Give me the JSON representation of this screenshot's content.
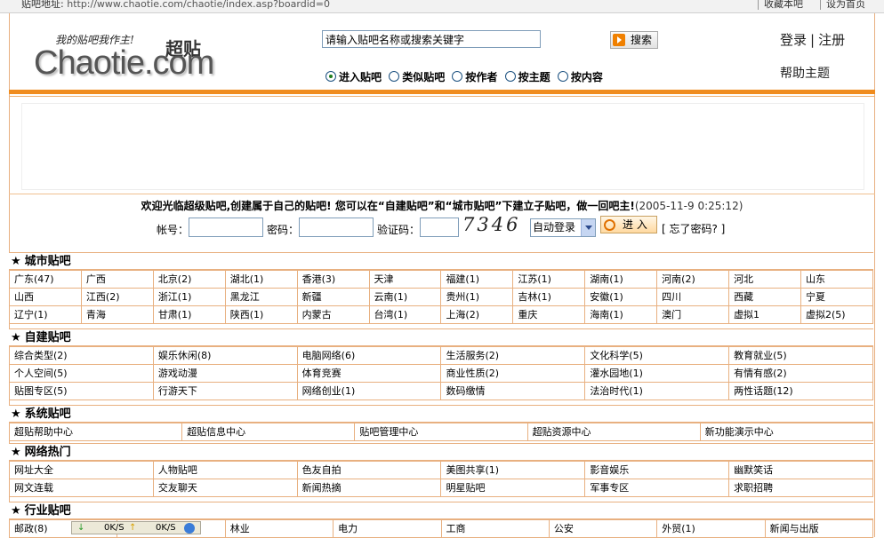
{
  "topbar": {
    "address_label": "贴吧地址:",
    "address_url": "http://www.chaotie.com/chaotie/index.asp?boardid=0",
    "bookmark": "收藏本吧",
    "homepage": "设为首页"
  },
  "logo": {
    "slogan": "我的贴吧我作主!",
    "cn_name": "超贴",
    "en_name": "Chaotie.com"
  },
  "search": {
    "value": "请输入贴吧名称或搜索关键字",
    "button": "搜索",
    "options": [
      "进入贴吧",
      "类似贴吧",
      "按作者",
      "按主题",
      "按内容"
    ],
    "selected_index": 0
  },
  "header_links": {
    "login": "登录",
    "register": "注册",
    "help": "帮助主题"
  },
  "welcome": {
    "text": "欢迎光临超级贴吧,创建属于自己的贴吧! 您可以在“自建贴吧”和“城市贴吧”下建立子贴吧，做一回吧主!",
    "time": "(2005-11-9 0:25:12)"
  },
  "login_form": {
    "user_label": "帐号：",
    "password_label": "密码：",
    "captcha_label": "验证码：",
    "captcha_code": "7346",
    "auto_login": "自动登录",
    "enter": "进 入",
    "forgot": "[ 忘了密码? ]"
  },
  "sections": [
    {
      "title": "城市贴吧",
      "rows": [
        [
          "广东(47)",
          "广西",
          "北京(2)",
          "湖北(1)",
          "香港(3)",
          "天津",
          "福建(1)",
          "江苏(1)",
          "湖南(1)",
          "河南(2)",
          "河北",
          "山东"
        ],
        [
          "山西",
          "江西(2)",
          "浙江(1)",
          "黑龙江",
          "新疆",
          "云南(1)",
          "贵州(1)",
          "吉林(1)",
          "安徽(1)",
          "四川",
          "西藏",
          "宁夏"
        ],
        [
          "辽宁(1)",
          "青海",
          "甘肃(1)",
          "陕西(1)",
          "内蒙古",
          "台湾(1)",
          "上海(2)",
          "重庆",
          "海南(1)",
          "澳门",
          "虚拟1",
          "虚拟2(5)"
        ]
      ]
    },
    {
      "title": "自建贴吧",
      "rows": [
        [
          "综合类型(2)",
          "娱乐休闲(8)",
          "电脑网络(6)",
          "生活服务(2)",
          "文化科学(5)",
          "教育就业(5)"
        ],
        [
          "个人空间(5)",
          "游戏动漫",
          "体育竞赛",
          "商业性质(2)",
          "灌水园地(1)",
          "有情有感(2)"
        ],
        [
          "贴图专区(5)",
          "行游天下",
          "网络创业(1)",
          "数码缴情",
          "法治时代(1)",
          "两性话题(12)"
        ]
      ]
    },
    {
      "title": "系统贴吧",
      "rows": [
        [
          "超贴帮助中心",
          "超贴信息中心",
          "贴吧管理中心",
          "超贴资源中心",
          "新功能演示中心"
        ]
      ]
    },
    {
      "title": "网络热门",
      "rows": [
        [
          "网址大全",
          "人物贴吧",
          "色友自拍",
          "美图共享(1)",
          "影音娱乐",
          "幽默笑话"
        ],
        [
          "网文连载",
          "交友聊天",
          "新闻热摘",
          "明星贴吧",
          "军事专区",
          "求职招聘"
        ]
      ]
    },
    {
      "title": "行业贴吧",
      "rows": [
        [
          "邮政(8)",
          "",
          "林业",
          "电力",
          "工商",
          "公安",
          "外贸(1)",
          "新闻与出版"
        ]
      ]
    }
  ],
  "status_bar": {
    "down_rate": "0K/S",
    "up_rate": "0K/S"
  }
}
